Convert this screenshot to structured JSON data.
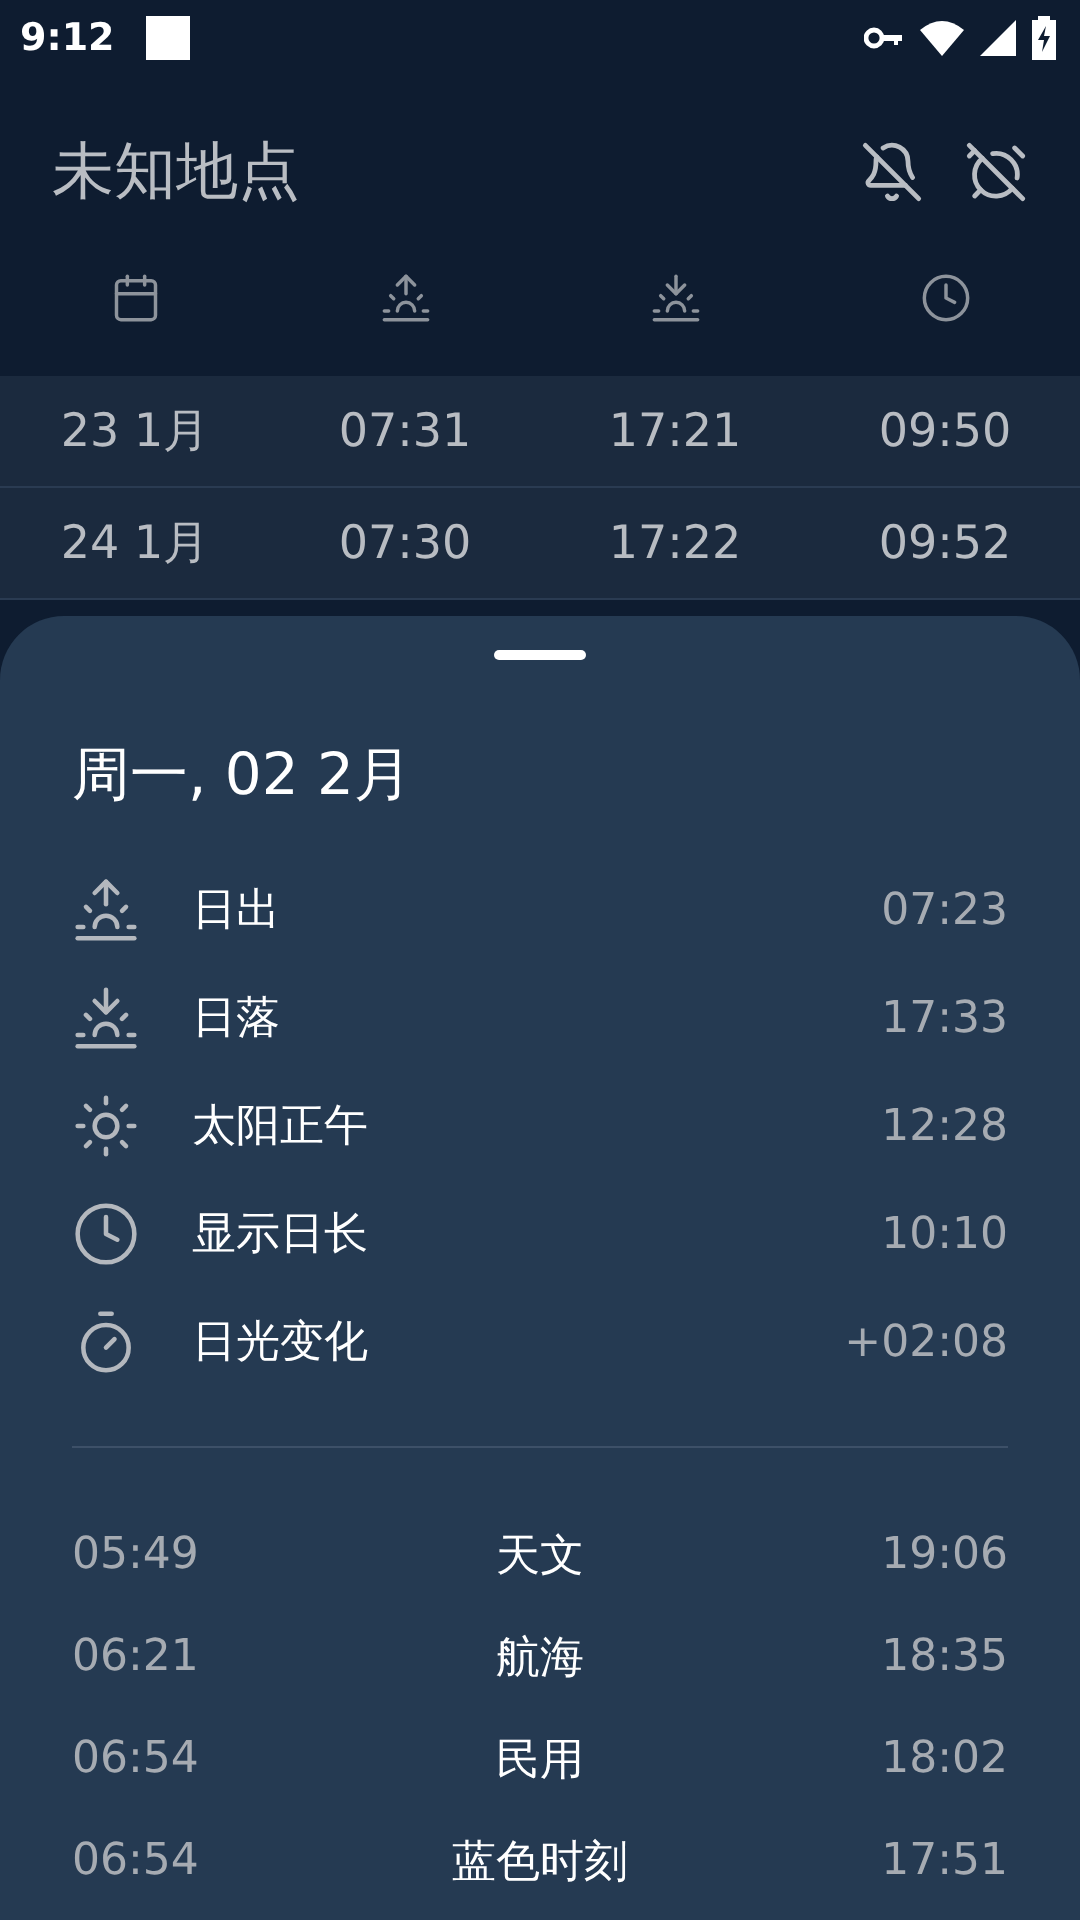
{
  "status_bar": {
    "time": "9:12"
  },
  "title": "未知地点",
  "columns": [
    {
      "kind": "date"
    },
    {
      "kind": "sunrise"
    },
    {
      "kind": "sunset"
    },
    {
      "kind": "daylength"
    }
  ],
  "rows": [
    {
      "cells": [
        "23 1月",
        "07:31",
        "17:21",
        "09:50"
      ]
    },
    {
      "cells": [
        "24 1月",
        "07:30",
        "17:22",
        "09:52"
      ]
    }
  ],
  "detail": {
    "date": "周一, 02 2月",
    "items": [
      {
        "kind": "sunrise",
        "label": "日出",
        "value": "07:23"
      },
      {
        "kind": "sunset",
        "label": "日落",
        "value": "17:33"
      },
      {
        "kind": "noon",
        "label": "太阳正午",
        "value": "12:28"
      },
      {
        "kind": "daylength",
        "label": "显示日长",
        "value": "10:10"
      },
      {
        "kind": "change",
        "label": "日光变化",
        "value": "+02:08"
      }
    ],
    "twilight": [
      {
        "dawn": "05:49",
        "name": "天文",
        "dusk": "19:06"
      },
      {
        "dawn": "06:21",
        "name": "航海",
        "dusk": "18:35"
      },
      {
        "dawn": "06:54",
        "name": "民用",
        "dusk": "18:02"
      },
      {
        "dawn": "06:54",
        "name": "蓝色时刻",
        "dusk": "17:51"
      }
    ]
  }
}
